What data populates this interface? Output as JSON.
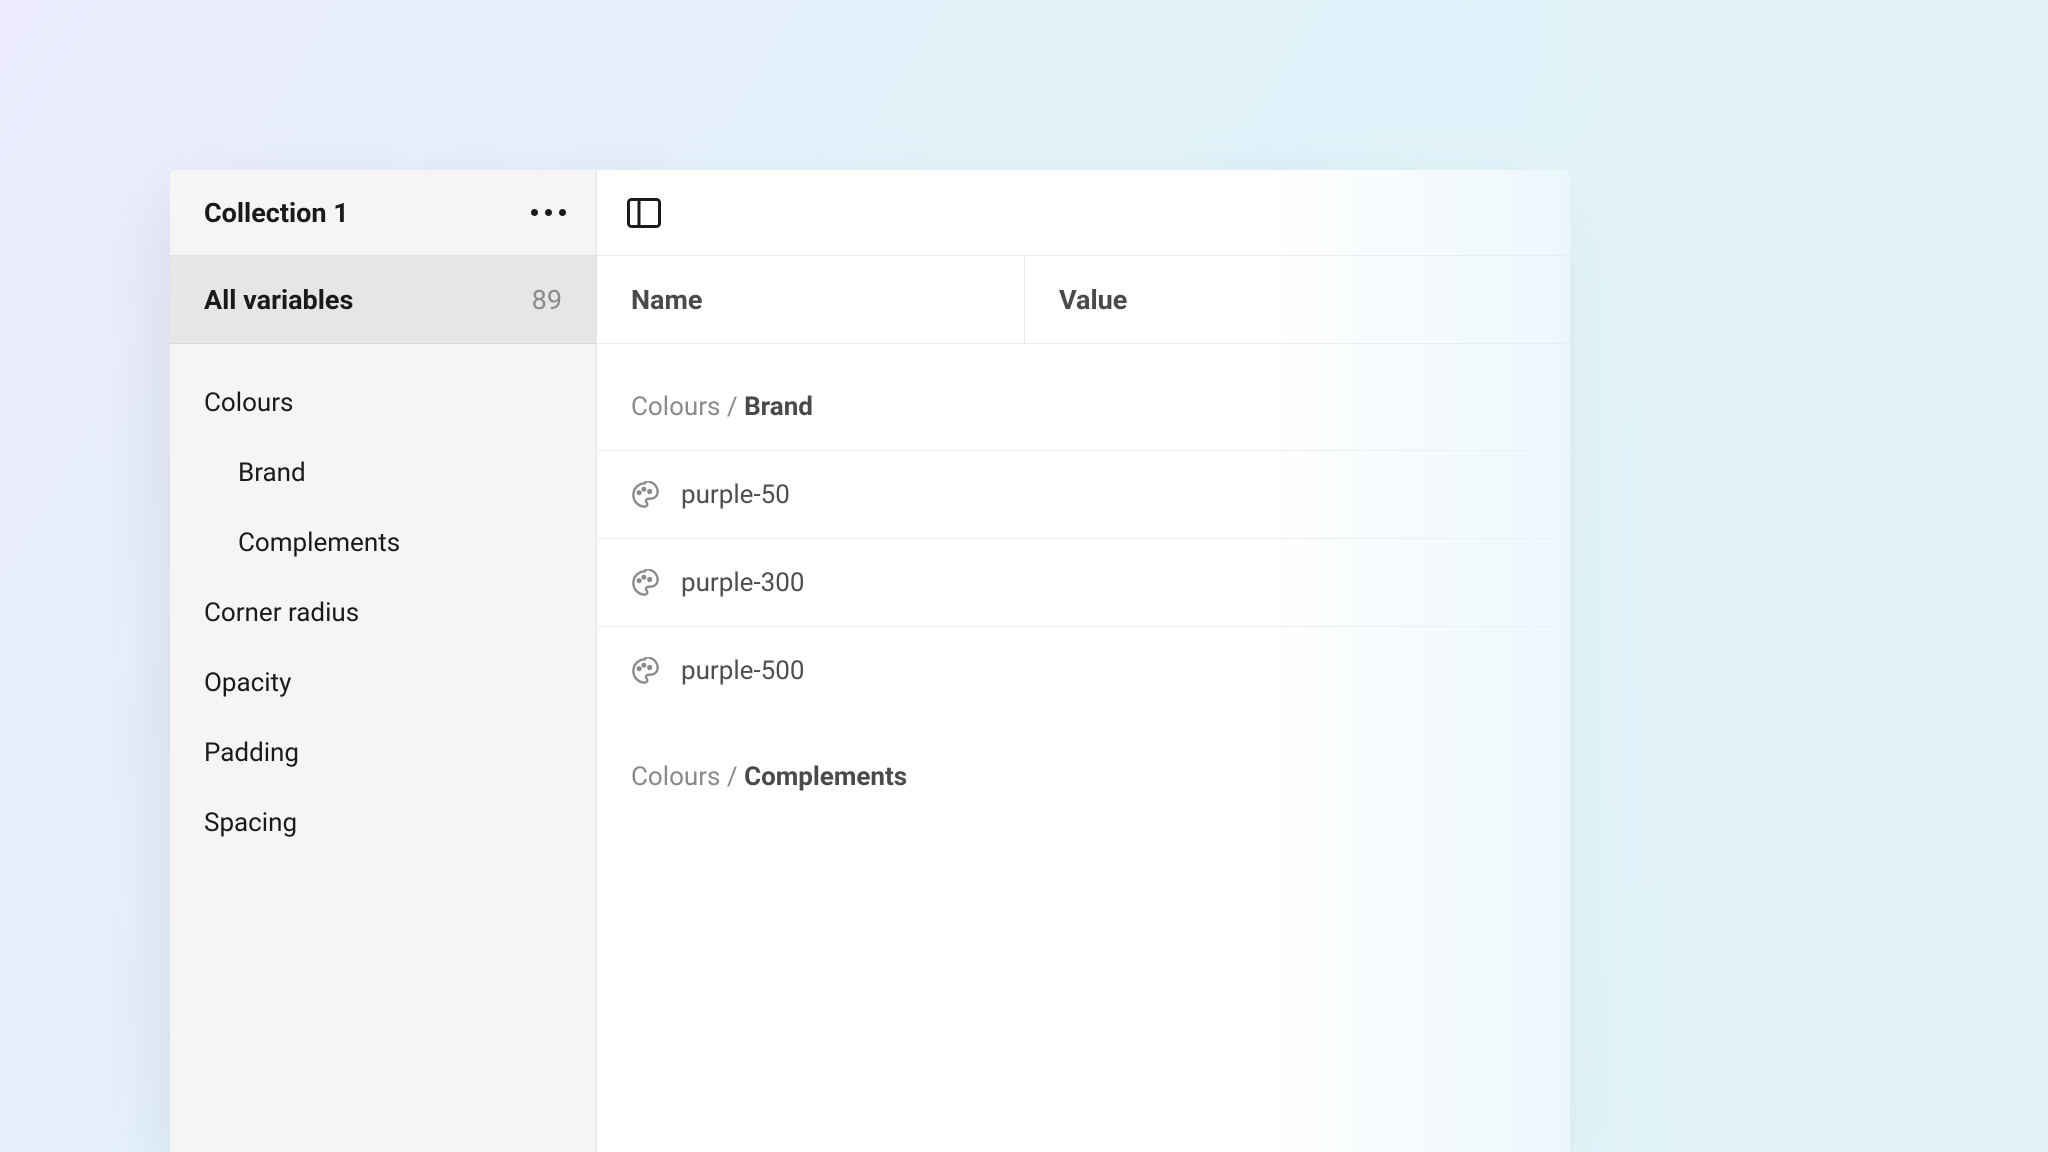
{
  "sidebar": {
    "collection_title": "Collection 1",
    "all_variables_label": "All variables",
    "all_variables_count": "89",
    "groups": [
      {
        "label": "Colours",
        "children": [
          {
            "label": "Brand"
          },
          {
            "label": "Complements"
          }
        ]
      },
      {
        "label": "Corner radius"
      },
      {
        "label": "Opacity"
      },
      {
        "label": "Padding"
      },
      {
        "label": "Spacing"
      }
    ]
  },
  "main": {
    "columns": {
      "name": "Name",
      "value": "Value"
    },
    "group1": {
      "path": "Colours / ",
      "name": "Brand"
    },
    "rows": [
      {
        "name": "purple-50"
      },
      {
        "name": "purple-300"
      },
      {
        "name": "purple-500"
      }
    ],
    "group2": {
      "path": "Colours / ",
      "name": "Complements"
    }
  }
}
